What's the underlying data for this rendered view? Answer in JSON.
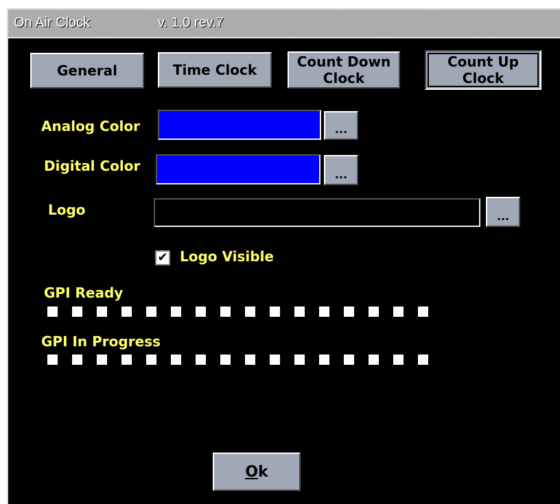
{
  "window": {
    "app_title": "On Air Clock",
    "version": "v. 1.0  rev.7"
  },
  "tabs": [
    {
      "label": "General",
      "active": false
    },
    {
      "label": "Time Clock",
      "active": false
    },
    {
      "label": "Count Down Clock",
      "active": false
    },
    {
      "label": "Count Up Clock",
      "active": true
    }
  ],
  "fields": {
    "analog_color": {
      "label": "Analog Color",
      "value": "#0000ff",
      "button": "..."
    },
    "digital_color": {
      "label": "Digital Color",
      "value": "#0000ff",
      "button": "..."
    },
    "logo": {
      "label": "Logo",
      "value": "",
      "button": "..."
    }
  },
  "logo_visible": {
    "label": "Logo Visible",
    "checked": true,
    "check_glyph": "✔"
  },
  "gpi_ready": {
    "label": "GPI Ready",
    "count": 16
  },
  "gpi_in_progress": {
    "label": "GPI In Progress",
    "count": 16
  },
  "ok_button": {
    "label": "Ok",
    "mnemonic": "O",
    "rest": "k"
  },
  "colors": {
    "background": "#000000",
    "label_yellow": "#ffff66",
    "button_face": "#a0a8b8",
    "swatch_blue": "#0000ff"
  }
}
